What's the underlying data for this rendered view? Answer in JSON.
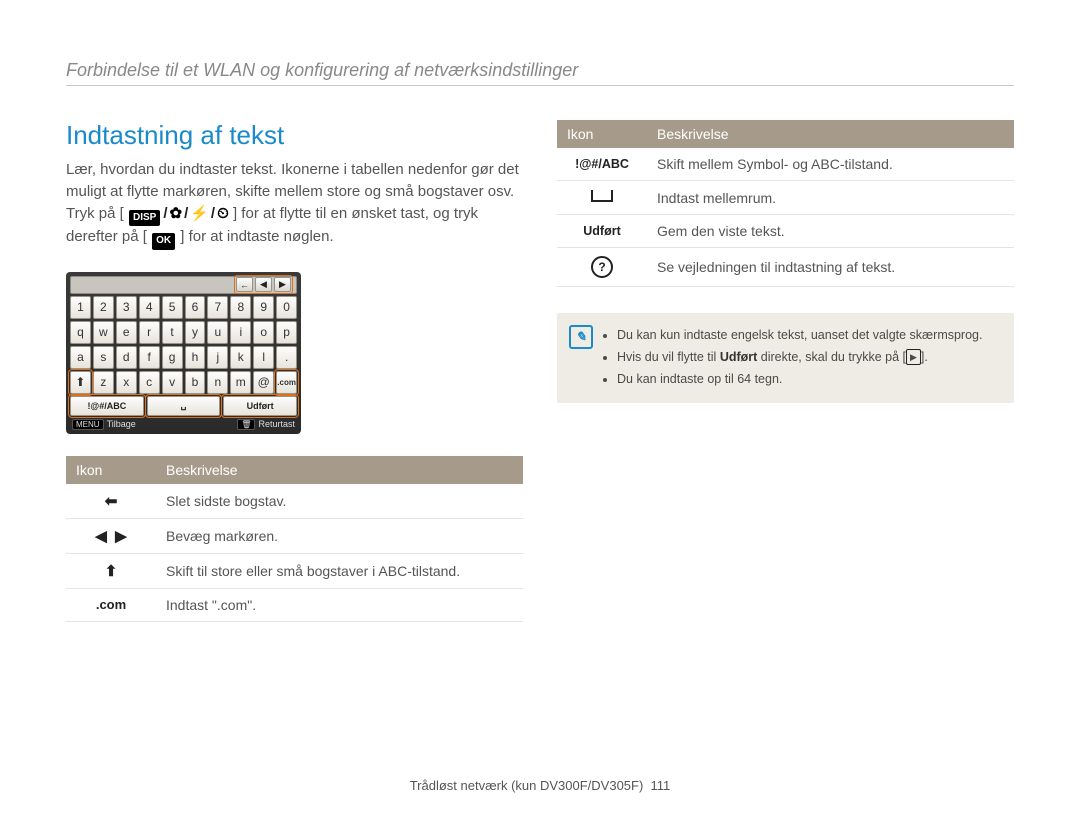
{
  "header": {
    "breadcrumb": "Forbindelse til et WLAN og konfigurering af netværksindstillinger"
  },
  "section_title": "Indtastning af tekst",
  "body_paragraph_pre": "Lær, hvordan du indtaster tekst. Ikonerne i tabellen nedenfor gør det muligt at flytte markøren, skifte mellem store og små bogstaver osv. Tryk på [",
  "disp_label": "DISP",
  "body_paragraph_mid": "] for at flytte til en ønsket tast, og tryk derefter på [",
  "ok_label": "OK",
  "body_paragraph_post": "] for at indtaste nøglen.",
  "keyboard": {
    "nav_back_glyph": "←",
    "nav_left_glyph": "◀",
    "nav_right_glyph": "▶",
    "rows": [
      [
        "1",
        "2",
        "3",
        "4",
        "5",
        "6",
        "7",
        "8",
        "9",
        "0"
      ],
      [
        "q",
        "w",
        "e",
        "r",
        "t",
        "y",
        "u",
        "i",
        "o",
        "p"
      ],
      [
        "a",
        "s",
        "d",
        "f",
        "g",
        "h",
        "j",
        "k",
        "l",
        "."
      ]
    ],
    "z_row": {
      "shift_glyph": "⬆",
      "keys": [
        "z",
        "x",
        "c",
        "v",
        "b",
        "n",
        "m",
        "@"
      ],
      "com": ".com"
    },
    "bottom": {
      "mode": "!@#/ABC",
      "space_glyph": "␣",
      "done": "Udført"
    },
    "status": {
      "menu_tag": "MENU",
      "back": "Tilbage",
      "trash_tag": "🗑",
      "enter": "Returtast"
    }
  },
  "table_left": {
    "head_icon": "Ikon",
    "head_desc": "Beskrivelse",
    "rows": [
      {
        "icon_type": "arrow-back",
        "desc": "Slet sidste bogstav."
      },
      {
        "icon_type": "arrows-lr",
        "desc": "Bevæg markøren."
      },
      {
        "icon_type": "arrow-up",
        "desc": "Skift til store eller små bogstaver i ABC-tilstand."
      },
      {
        "icon_type": "com",
        "icon_text": ".com",
        "desc": "Indtast \".com\"."
      }
    ]
  },
  "table_right": {
    "head_icon": "Ikon",
    "head_desc": "Beskrivelse",
    "rows": [
      {
        "icon_type": "text",
        "icon_text": "!@#/ABC",
        "desc": "Skift mellem Symbol- og ABC-tilstand."
      },
      {
        "icon_type": "space",
        "desc": "Indtast mellemrum."
      },
      {
        "icon_type": "text",
        "icon_text": "Udført",
        "desc": "Gem den viste tekst."
      },
      {
        "icon_type": "question",
        "desc": "Se vejledningen til indtastning af tekst."
      }
    ]
  },
  "note": {
    "items": [
      {
        "pre": "Du kan kun indtaste engelsk tekst, uanset det valgte skærmsprog."
      },
      {
        "pre": "Hvis du vil flytte til ",
        "bold": "Udført",
        "mid": " direkte, skal du trykke på [",
        "playbox": "▶",
        "post": "]."
      },
      {
        "pre": "Du kan indtaste op til 64 tegn."
      }
    ]
  },
  "footer": {
    "section": "Trådløst netværk (kun DV300F/DV305F)",
    "page_number": "111"
  }
}
